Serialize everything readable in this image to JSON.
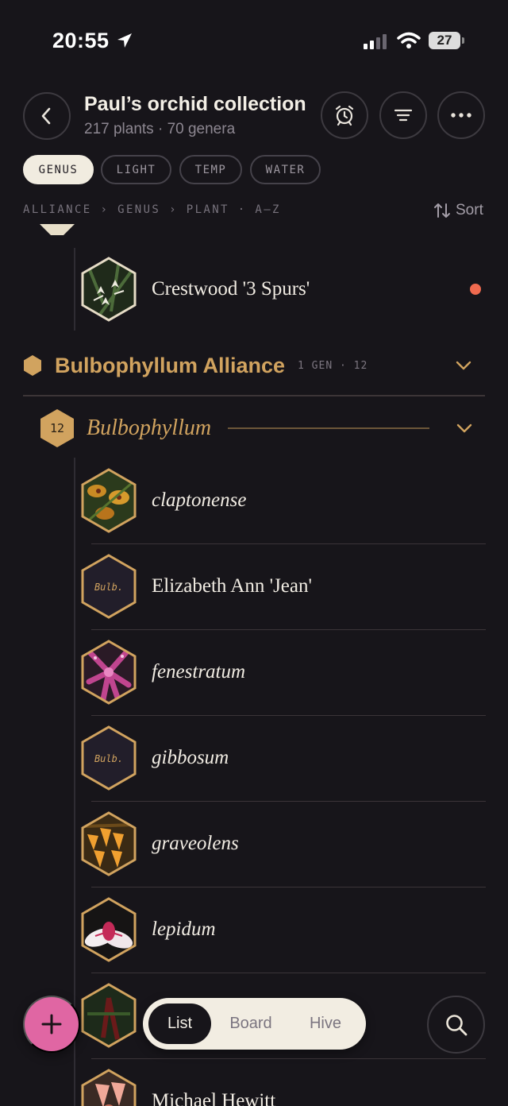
{
  "status": {
    "time": "20:55",
    "battery": "27"
  },
  "header": {
    "title": "Paul’s orchid collection",
    "subtitle": "217 plants · 70 genera"
  },
  "filters": [
    "GENUS",
    "LIGHT",
    "TEMP",
    "WATER"
  ],
  "breadcrumb": "ALLIANCE › GENUS › PLANT · A—Z",
  "sort_label": "Sort",
  "list": {
    "top_plant": {
      "name": "Crestwood '3 Spurs'",
      "has_alert": true
    },
    "alliance": {
      "name": "Bulbophyllum Alliance",
      "meta": "1 GEN · 12"
    },
    "genus": {
      "name": "Bulbophyllum",
      "count": "12",
      "abbrev": "Bulb."
    },
    "plants": [
      {
        "name": "claptonense",
        "italic": true,
        "thumb": "photo"
      },
      {
        "name": "Elizabeth Ann 'Jean'",
        "italic": false,
        "thumb": "placeholder"
      },
      {
        "name": "fenestratum",
        "italic": true,
        "thumb": "photo"
      },
      {
        "name": "gibbosum",
        "italic": true,
        "thumb": "placeholder"
      },
      {
        "name": "graveolens",
        "italic": true,
        "thumb": "photo"
      },
      {
        "name": "lepidum",
        "italic": true,
        "thumb": "photo"
      },
      {
        "name": "",
        "italic": true,
        "thumb": "photo"
      },
      {
        "name": "Michael Hewitt",
        "italic": false,
        "thumb": "photo"
      }
    ]
  },
  "view_switch": {
    "tabs": [
      "List",
      "Board",
      "Hive"
    ],
    "active": "List"
  },
  "colors": {
    "accent": "#d1a35f",
    "add_button": "#e066a3",
    "alert": "#f06a4f",
    "background": "#17151a"
  }
}
